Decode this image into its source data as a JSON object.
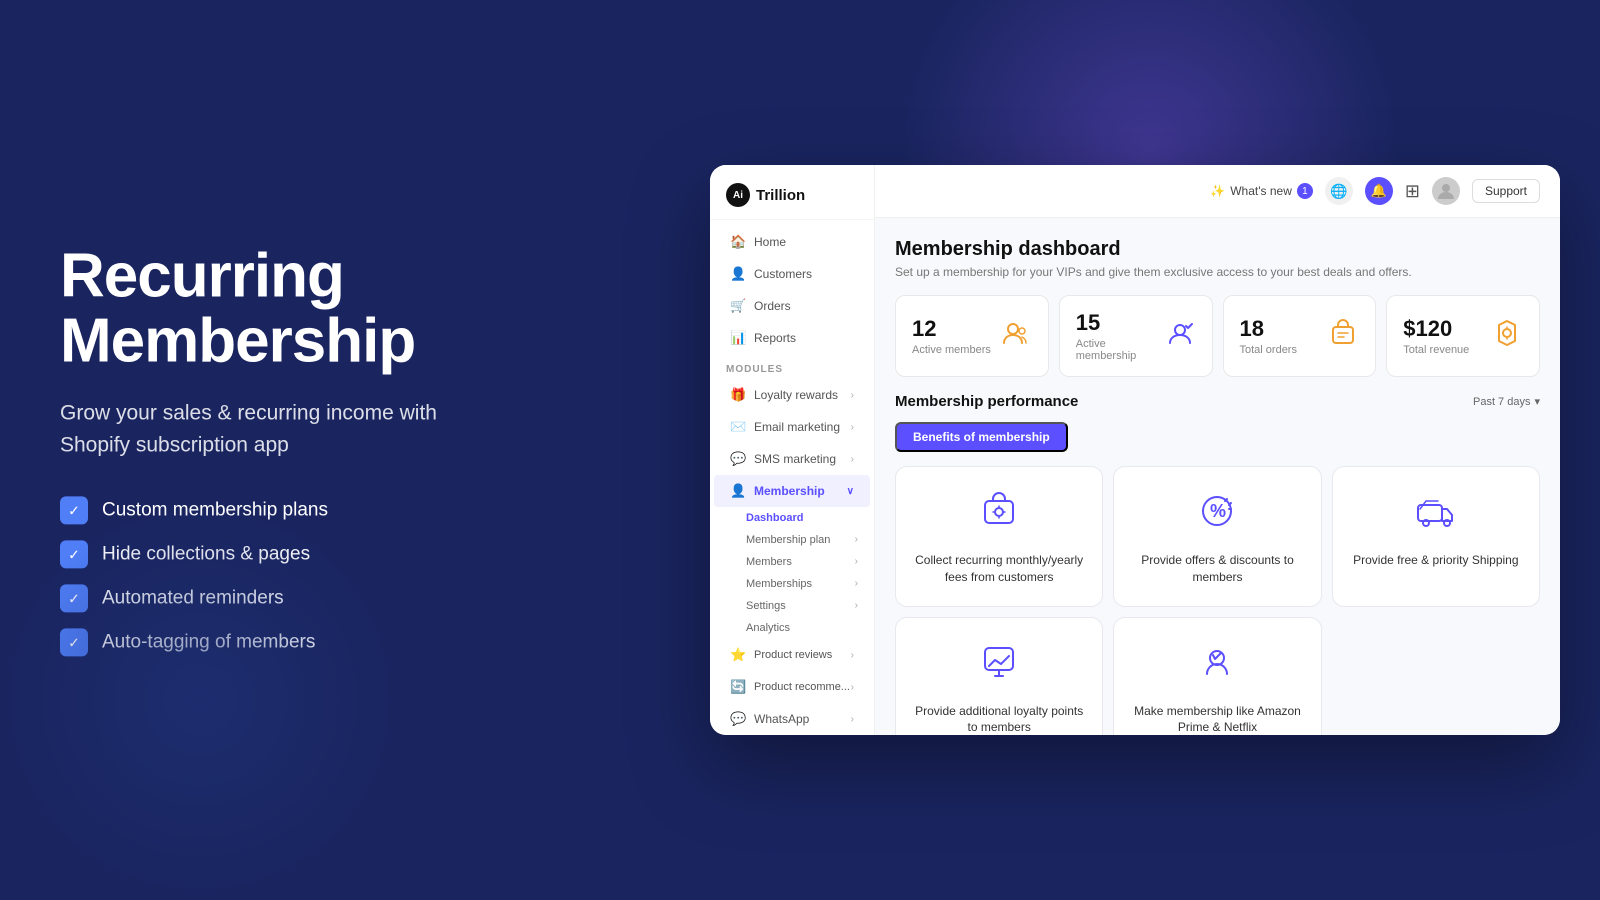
{
  "left": {
    "title_line1": "Recurring",
    "title_line2": "Membership",
    "subtitle": "Grow your sales & recurring income with Shopify subscription app",
    "features": [
      "Custom membership plans",
      "Hide collections & pages",
      "Automated reminders",
      "Auto-tagging of members"
    ]
  },
  "topbar": {
    "whats_new_label": "What's new",
    "whats_new_badge": "1",
    "support_label": "Support"
  },
  "sidebar": {
    "logo_text": "Trillion",
    "logo_ai": "Ai",
    "nav_items": [
      {
        "label": "Home",
        "icon": "🏠"
      },
      {
        "label": "Customers",
        "icon": "👤"
      },
      {
        "label": "Orders",
        "icon": "🛒"
      },
      {
        "label": "Reports",
        "icon": "📊"
      }
    ],
    "modules_label": "MODULES",
    "module_items": [
      {
        "label": "Loyalty rewards",
        "icon": "🎁",
        "expandable": true
      },
      {
        "label": "Email marketing",
        "icon": "✉️",
        "expandable": true
      },
      {
        "label": "SMS marketing",
        "icon": "💬",
        "expandable": true
      },
      {
        "label": "Membership",
        "icon": "👤",
        "expandable": true,
        "active": true
      }
    ],
    "submenu": [
      {
        "label": "Dashboard",
        "active": true
      },
      {
        "label": "Membership plan",
        "expandable": true
      },
      {
        "label": "Members",
        "expandable": true
      },
      {
        "label": "Memberships",
        "expandable": true
      },
      {
        "label": "Settings",
        "expandable": true
      },
      {
        "label": "Analytics"
      }
    ],
    "bottom_items": [
      {
        "label": "Product reviews",
        "icon": "⭐",
        "expandable": true
      },
      {
        "label": "Product recomme...",
        "icon": "🔄",
        "expandable": true
      },
      {
        "label": "WhatsApp",
        "icon": "💬",
        "expandable": true
      }
    ]
  },
  "dashboard": {
    "title": "Membership dashboard",
    "subtitle": "Set up a membership for your VIPs and give them exclusive access to your best deals and offers.",
    "stats": [
      {
        "number": "12",
        "label": "Active members"
      },
      {
        "number": "15",
        "label": "Active membership"
      },
      {
        "number": "18",
        "label": "Total orders"
      },
      {
        "number": "$120",
        "label": "Total revenue"
      }
    ],
    "performance_title": "Membership performance",
    "period_label": "Past 7 days",
    "tab_active": "Benefits of membership",
    "benefits": [
      {
        "text": "Collect recurring monthly/yearly fees from customers",
        "icon": "collect"
      },
      {
        "text": "Provide offers & discounts to members",
        "icon": "discount"
      },
      {
        "text": "Provide free & priority Shipping",
        "icon": "shipping"
      },
      {
        "text": "Provide additional loyalty points to members",
        "icon": "loyalty"
      },
      {
        "text": "Make membership like Amazon Prime & Netflix",
        "icon": "prime"
      }
    ]
  }
}
